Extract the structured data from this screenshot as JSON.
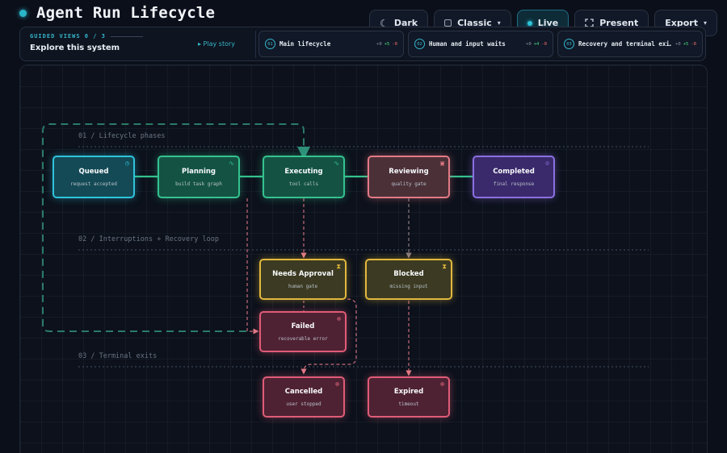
{
  "app": {
    "title": "Agent Run Lifecycle"
  },
  "toolbar": {
    "dark_label": "Dark",
    "classic_label": "Classic",
    "live_label": "Live",
    "present_label": "Present",
    "export_label": "Export"
  },
  "guided": {
    "label": "GUIDED VIEWS 0 / 3",
    "title": "Explore this system",
    "play_label": "▸ Play story",
    "views": [
      {
        "num": "01",
        "name": "Main lifecycle",
        "stat_a": "+0",
        "stat_b": "+5",
        "stat_c": "-0"
      },
      {
        "num": "02",
        "name": "Human and input waits",
        "stat_a": "+0",
        "stat_b": "+4",
        "stat_c": "-0"
      },
      {
        "num": "03",
        "name": "Recovery and terminal exi…",
        "stat_a": "+0",
        "stat_b": "+5",
        "stat_c": "-0"
      }
    ]
  },
  "sections": {
    "s1": "01 / Lifecycle phases",
    "s2": "02 / Interruptions + Recovery loop",
    "s3": "03 / Terminal exits"
  },
  "nodes": {
    "queued": {
      "title": "Queued",
      "sub": "request accepted",
      "icon": "clock-icon"
    },
    "planning": {
      "title": "Planning",
      "sub": "build task graph",
      "icon": "pulse-icon"
    },
    "executing": {
      "title": "Executing",
      "sub": "tool calls",
      "icon": "pulse-icon"
    },
    "reviewing": {
      "title": "Reviewing",
      "sub": "quality gate",
      "icon": "square-icon"
    },
    "completed": {
      "title": "Completed",
      "sub": "final response",
      "icon": "check-circle-icon"
    },
    "approval": {
      "title": "Needs Approval",
      "sub": "human gate",
      "icon": "hourglass-icon"
    },
    "blocked": {
      "title": "Blocked",
      "sub": "missing input",
      "icon": "hourglass-icon"
    },
    "failed": {
      "title": "Failed",
      "sub": "recoverable error",
      "icon": "x-circle-icon"
    },
    "cancelled": {
      "title": "Cancelled",
      "sub": "user stopped",
      "icon": "x-circle-icon"
    },
    "expired": {
      "title": "Expired",
      "sub": "timeout",
      "icon": "x-circle-icon"
    }
  },
  "colors": {
    "accent": "#2bb5c8",
    "cyan": "#2fc3dc",
    "green": "#34c28f",
    "pink": "#e37a85",
    "purple": "#8b6fe0",
    "yellow": "#e2b83d",
    "red": "#e05b77"
  }
}
